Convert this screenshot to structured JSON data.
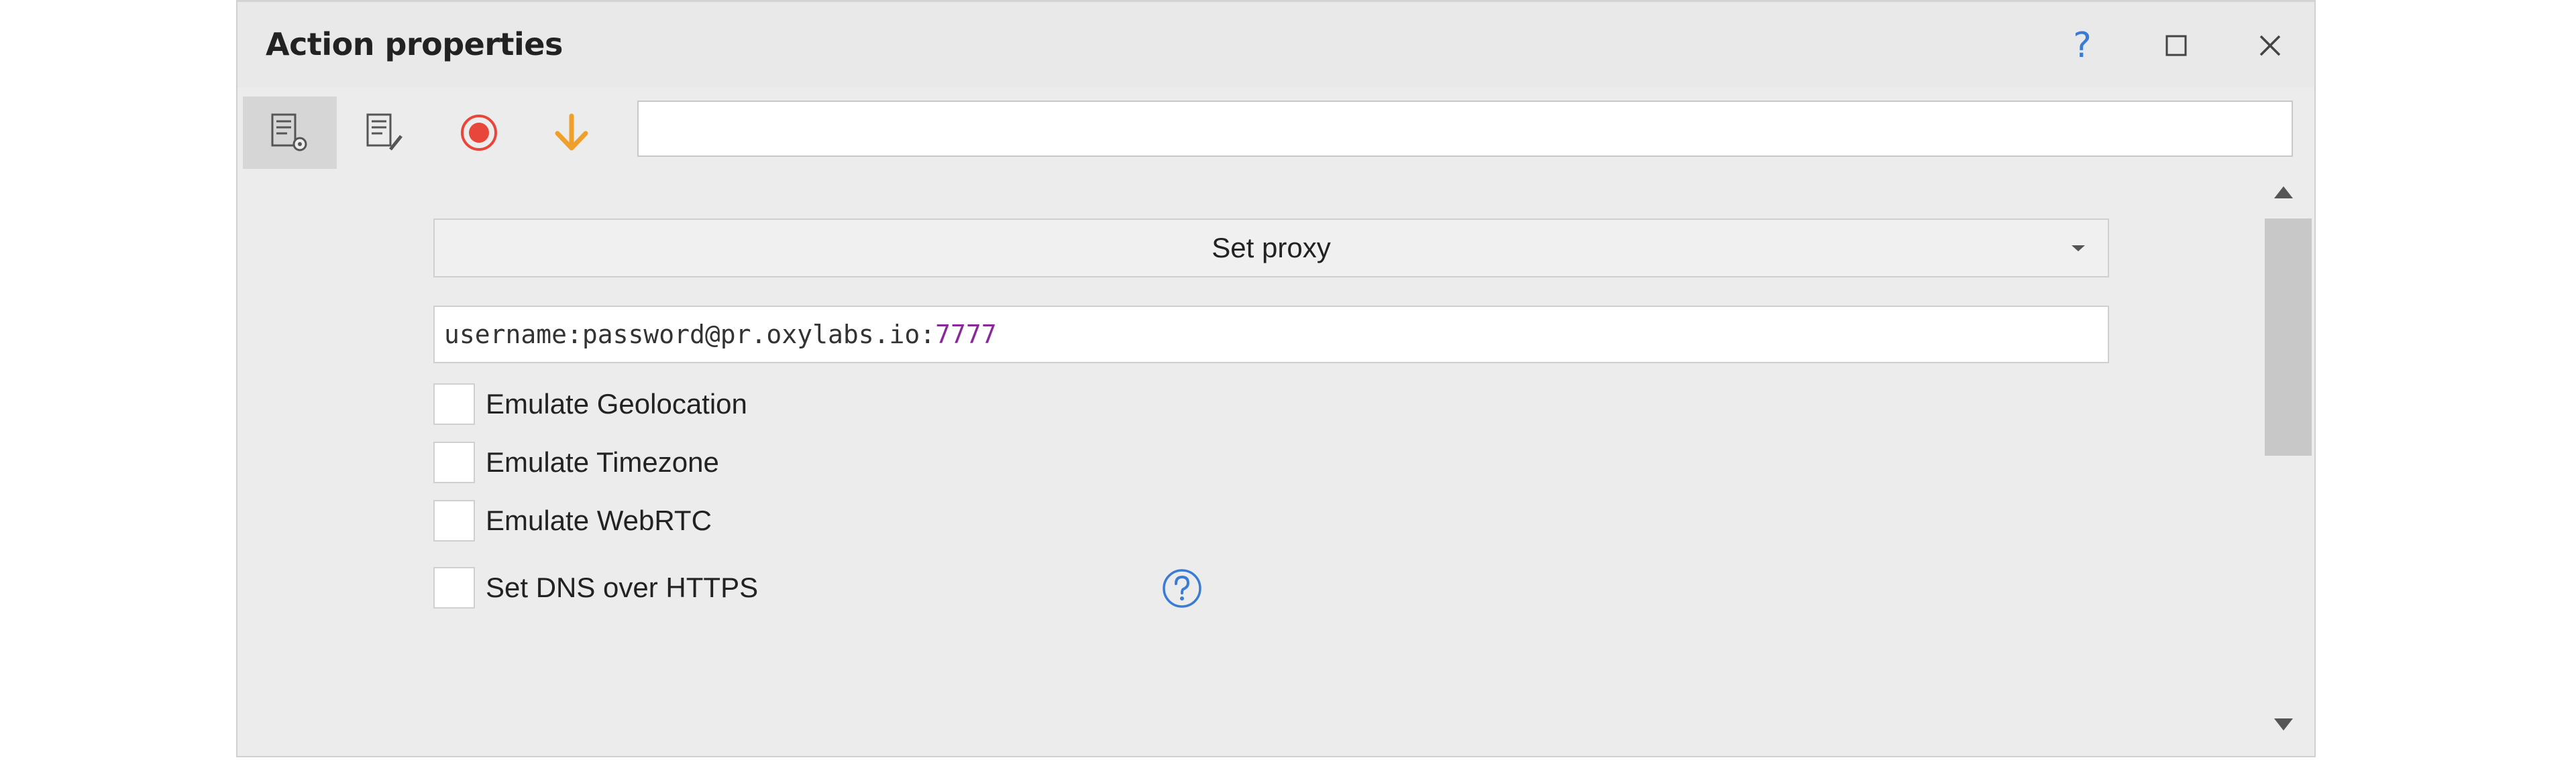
{
  "window": {
    "title": "Action properties",
    "help_label": "?"
  },
  "toolbar": {
    "search_value": ""
  },
  "action": {
    "selected": "Set proxy",
    "proxy_prefix": "username:password@pr.oxylabs.io:",
    "proxy_port": "7777"
  },
  "options": [
    {
      "label": "Emulate Geolocation",
      "checked": false
    },
    {
      "label": "Emulate Timezone",
      "checked": false
    },
    {
      "label": "Emulate WebRTC",
      "checked": false
    },
    {
      "label": "Set DNS over HTTPS",
      "checked": false
    }
  ],
  "colors": {
    "accent_blue": "#3a7bd5",
    "record_red": "#e8463b",
    "arrow_orange": "#f0a02a",
    "port_purple": "#8a2a9a"
  }
}
